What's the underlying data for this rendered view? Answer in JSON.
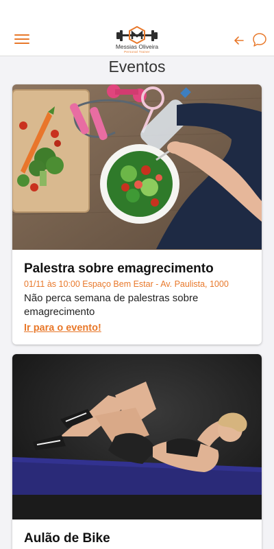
{
  "header": {
    "logo_name": "Messias Oliveira",
    "logo_sub": "Personal Trainer",
    "menu_icon": "hamburger-menu-icon",
    "back_icon": "arrow-left-icon",
    "chat_icon": "chat-bubble-icon"
  },
  "page_title": "Eventos",
  "events": [
    {
      "title": "Palestra sobre emagrecimento",
      "meta": "01/11 às 10:00 Espaço Bem Estar - Av. Paulista, 1000",
      "description": "Não perca semana de palestras sobre emagrecimento",
      "link_label": "Ir para o evento!"
    },
    {
      "title": "Aulão de Bike"
    }
  ],
  "colors": {
    "accent": "#e8782a",
    "background": "#f3f3f6",
    "card": "#ffffff"
  }
}
